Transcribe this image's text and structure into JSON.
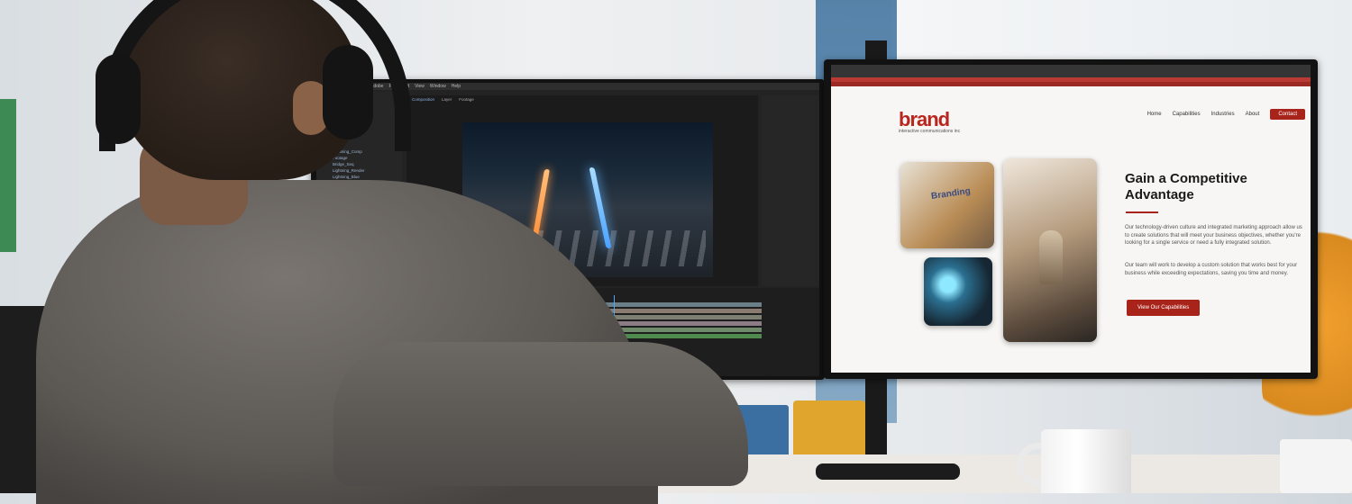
{
  "scene": {
    "description_type": "photo of a person at a dual-monitor workstation",
    "colors": {
      "brand_red": "#a8241b",
      "screen_dark": "#232323",
      "wall_blue": "#3d6f9c"
    }
  },
  "editor": {
    "menu": [
      "Adobe",
      "File",
      "Edit",
      "View",
      "Window",
      "Help"
    ],
    "viewer_tabs": [
      "Composition",
      "Layer",
      "Footage"
    ],
    "project_items": [
      "Lightning_Comp",
      "Footage",
      "Bridge_Seq",
      "Lightning_Render",
      "Lightning_Blue",
      "Lightning_Orange",
      "Solids",
      "Street_Night",
      "Precomps",
      "Audio",
      "Lightning_Strike",
      "Background_Shot"
    ]
  },
  "website": {
    "logo_word": "brand",
    "logo_sub": "interactive communications inc",
    "nav": [
      "Home",
      "Capabilities",
      "Industries",
      "About"
    ],
    "nav_cta": "Contact",
    "photo1_label": "Branding",
    "hero_title": "Gain a Competitive Advantage",
    "hero_p1": "Our technology-driven culture and integrated marketing approach allow us to create solutions that will meet your business objectives, whether you're looking for a single service or need a fully integrated solution.",
    "hero_p2": "Our team will work to develop a custom solution that works best for your business while exceeding expectations, saving you time and money.",
    "hero_button": "View Our Capabilities"
  }
}
